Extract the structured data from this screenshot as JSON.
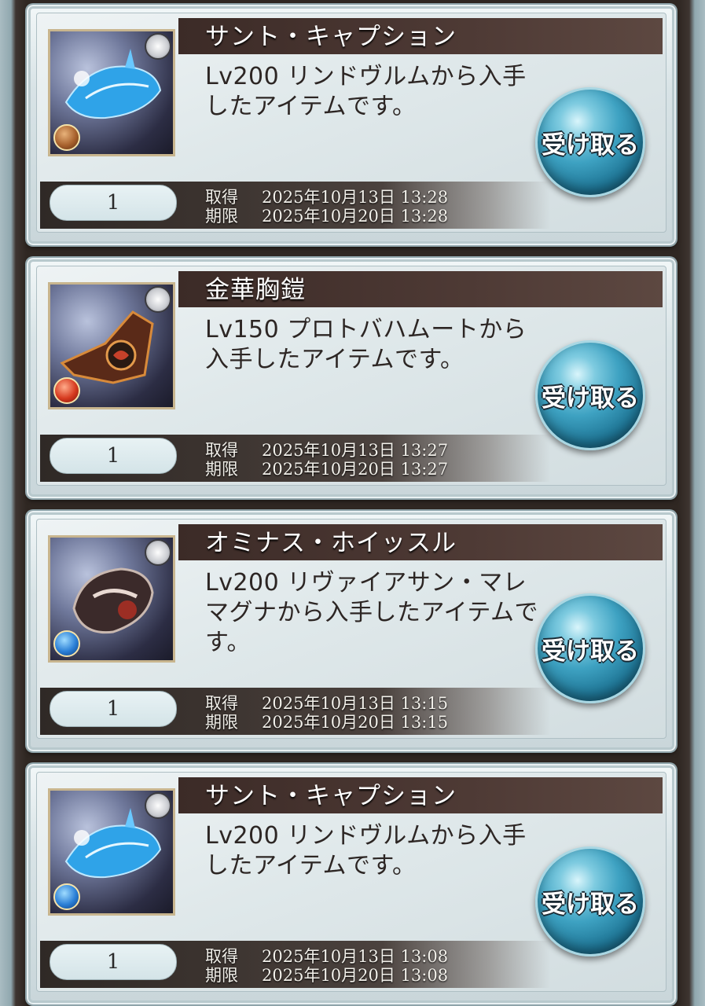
{
  "items": [
    {
      "name": "サント・キャプション",
      "description": "Lv200 リンドヴルムから入手したアイテムです。",
      "quantity": "1",
      "acquired_label": "取得",
      "acquired": "2025年10月13日 13:28",
      "expiry_label": "期限",
      "expiry": "2025年10月20日 13:28",
      "button_label": "受け取る",
      "weapon_icon": "sword-icon",
      "element_icon": "earth-element-icon"
    },
    {
      "name": "金華胸鎧",
      "description": "Lv150 プロトバハムートから入手したアイテムです。",
      "quantity": "1",
      "acquired_label": "取得",
      "acquired": "2025年10月13日 13:27",
      "expiry_label": "期限",
      "expiry": "2025年10月20日 13:27",
      "button_label": "受け取る",
      "weapon_icon": "bow-icon",
      "element_icon": "fire-element-icon"
    },
    {
      "name": "オミナス・ホイッスル",
      "description": "Lv200 リヴァイアサン・マレマグナから入手したアイテムです。",
      "quantity": "1",
      "acquired_label": "取得",
      "acquired": "2025年10月13日 13:15",
      "expiry_label": "期限",
      "expiry": "2025年10月20日 13:15",
      "button_label": "受け取る",
      "weapon_icon": "harp-icon",
      "element_icon": "water-element-icon"
    },
    {
      "name": "サント・キャプション",
      "description": "Lv200 リンドヴルムから入手したアイテムです。",
      "quantity": "1",
      "acquired_label": "取得",
      "acquired": "2025年10月13日 13:08",
      "expiry_label": "期限",
      "expiry": "2025年10月20日 13:08",
      "button_label": "受け取る",
      "weapon_icon": "sword-icon",
      "element_icon": "water-element-icon"
    }
  ]
}
